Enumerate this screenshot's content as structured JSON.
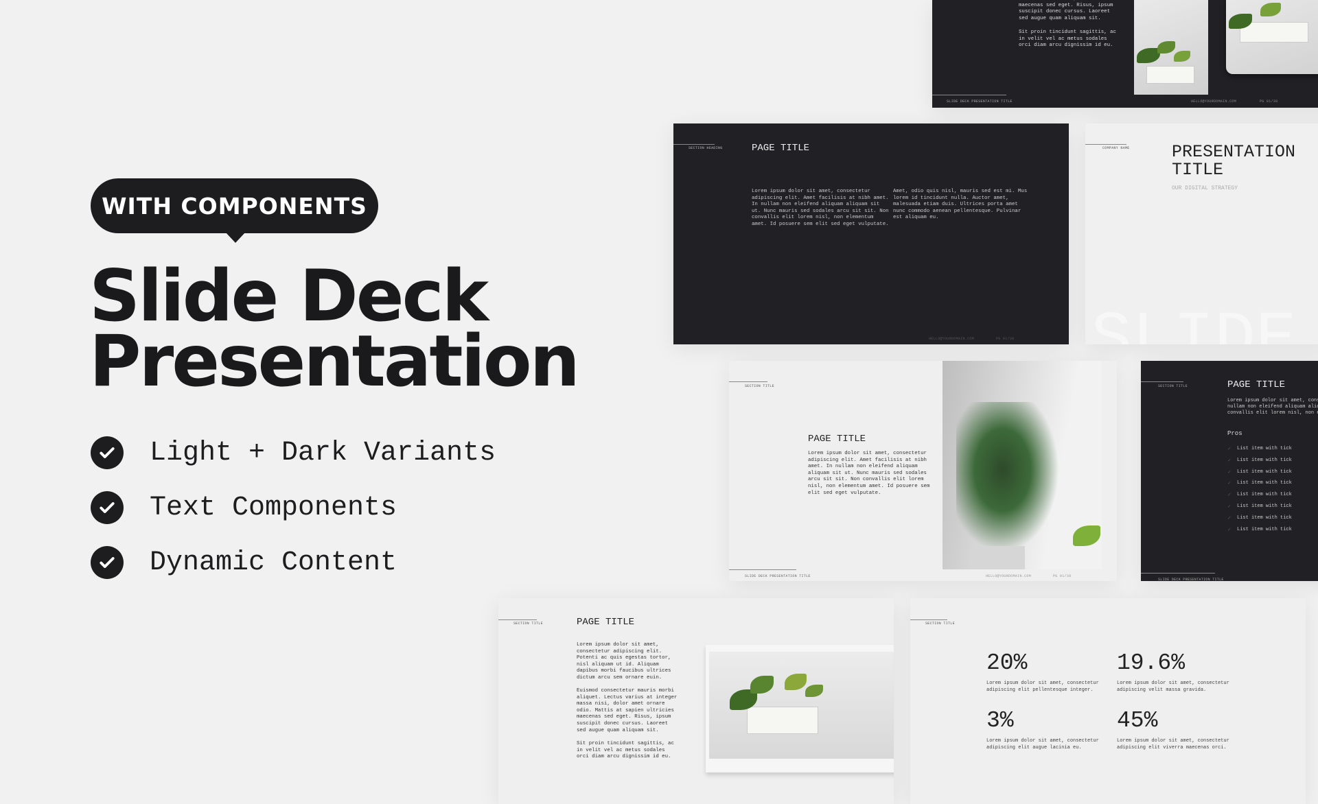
{
  "hero": {
    "badge": "WITH COMPONENTS",
    "title_line1": "Slide Deck",
    "title_line2": "Presentation",
    "features": [
      "Light + Dark Variants",
      "Text Components",
      "Dynamic Content"
    ]
  },
  "footer": {
    "deck_title": "SLIDE DECK PRESENTATION TITLE",
    "email": "HELLO@YOURDOMAIN.COM",
    "page": "PG 01/38"
  },
  "slide_top": {
    "para1": "Odio. Mattis at sapien ultricies\nmaecenas sed eget. Risus, ipsum\nsuscipit donec cursus. Laoreet\nsed augue quam aliquam sit.",
    "para2": "Sit proin tincidunt sagittis, ac\nin velit vel ac metus sodales\norci diam arcu dignissim id eu."
  },
  "slide_dark_two_col": {
    "section": "SECTION HEADING",
    "title": "PAGE TITLE",
    "col1": "Lorem ipsum dolor sit amet, consectetur\nadipiscing elit. Amet facilisis at nibh amet.\nIn nullam non eleifend aliquam aliquam sit\nut. Nunc mauris sed sodales arcu sit sit. Non\nconvallis elit lorem nisl, non elementum\namet. Id posuere sem elit sed eget vulputate.",
    "col2": "Amet, odio quis nisl, mauris sed est mi. Mus\nlorem id tincidunt nulla. Auctor amet,\nmalesuada etiam duis. Ultrices porta amet\nnunc commodo aenean pellentesque. Pulvinar\nest aliquam eu."
  },
  "slide_title": {
    "company": "COMPANY NAME",
    "title": "PRESENTATION\nTITLE",
    "subtitle": "OUR DIGITAL STRATEGY",
    "watermark": "SLIDE"
  },
  "slide_light_image": {
    "section": "SECTION TITLE",
    "title": "PAGE TITLE",
    "body": "Lorem ipsum dolor sit amet, consectetur\nadipiscing elit. Amet facilisis at nibh\namet. In nullam non eleifend aliquam\naliquam sit ut. Nunc mauris sed sodales\narcu sit sit. Non convallis elit lorem\nnisl, non elementum amet. Id posuere sem\nelit sed eget vulputate."
  },
  "slide_dark_list": {
    "section": "SECTION TITLE",
    "title": "PAGE TITLE",
    "body": "Lorem ipsum dolor sit amet, consectetur\nnullam non eleifend aliquam aliquam\nconvallis elit lorem nisl, non elementum",
    "list_heading": "Pros",
    "items": [
      "List item with tick",
      "List item with tick",
      "List item with tick",
      "List item with tick",
      "List item with tick",
      "List item with tick",
      "List item with tick",
      "List item with tick"
    ]
  },
  "slide_light_text": {
    "section": "SECTION TITLE",
    "title": "PAGE TITLE",
    "para1": "Lorem ipsum dolor sit amet,\nconsectetur adipiscing elit.\nPotenti ac quis egestas tortor,\nnisl aliquam ut id. Aliquam\ndapibus morbi faucibus ultrices\ndictum arcu sem ornare euin.",
    "para2": "Euismod consectetur mauris morbi\naliquet. Lectus varius at integer\nmassa nisi, dolor amet ornare\nodio. Mattis at sapien ultricies\nmaecenas sed eget. Risus, ipsum\nsuscipit donec cursus. Laoreet\nsed augue quam aliquam sit.",
    "para3": "Sit proin tincidunt sagittis, ac\nin velit vel ac metus sodales\norci diam arcu dignissim id eu."
  },
  "slide_stats": {
    "section": "SECTION TITLE",
    "stats": [
      {
        "value": "20%",
        "text": "Lorem ipsum dolor sit amet, consectetur\nadipiscing elit pellentesque integer."
      },
      {
        "value": "19.6%",
        "text": "Lorem ipsum dolor sit amet, consectetur\nadipiscing velit massa gravida."
      },
      {
        "value": "3%",
        "text": "Lorem ipsum dolor sit amet, consectetur\nadipiscing elit augue lacinia eu."
      },
      {
        "value": "45%",
        "text": "Lorem ipsum dolor sit amet, consectetur\nadipiscing elit viverra maecenas orci."
      }
    ]
  },
  "colors": {
    "dark_slide": "#212125",
    "light_slide": "#efefef",
    "background": "#f1f1f1",
    "accent": "#1d1d20"
  }
}
